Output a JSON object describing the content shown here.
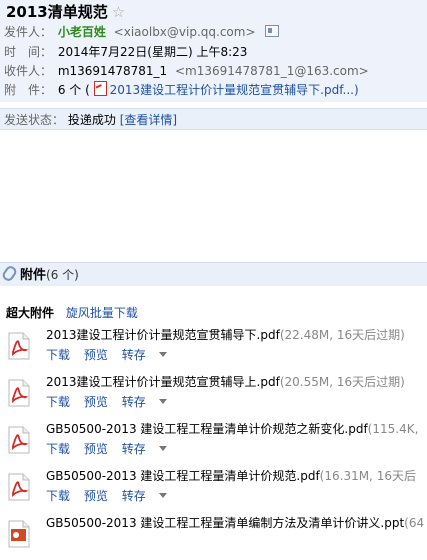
{
  "header": {
    "subject": "2013清单规范",
    "star": "☆",
    "sender_label": "发件人：",
    "sender_name": "小老百姓",
    "sender_email": "<xiaolbx@vip.qq.com>",
    "time_label": "时　间：",
    "time_value": "2014年7月22日(星期二) 上午8:23",
    "recipient_label": "收件人：",
    "recipient_name": "m13691478781_1",
    "recipient_email": "<m13691478781_1@163.com>",
    "attach_label": "附　件：",
    "attach_count": "6 个 (",
    "attach_first": "2013建设工程计价计量规范宣贯辅导下.pdf...)"
  },
  "status": {
    "label": "发送状态：",
    "value": "投递成功",
    "details_link": "[查看详情]"
  },
  "attachments": {
    "title": "附件",
    "count": "(6 个)",
    "super_label": "超大附件",
    "batch_download": "旋风批量下载",
    "download": "下载",
    "preview": "预览",
    "forward": "转存",
    "items": [
      {
        "name": "2013建设工程计价计量规范宣贯辅导下.pdf",
        "meta": "(22.48M, 16天后过期)",
        "icon": "pdf-icon"
      },
      {
        "name": "2013建设工程计价计量规范宣贯辅导上.pdf",
        "meta": "(20.55M, 16天后过期)",
        "icon": "pdf-icon"
      },
      {
        "name": "GB50500-2013 建设工程工程量清单计价规范之新变化.pdf",
        "meta": "(115.4K,",
        "icon": "pdf-icon"
      },
      {
        "name": "GB50500-2013 建设工程工程量清单计价规范.pdf",
        "meta": "(16.31M, 16天后",
        "icon": "pdf-icon"
      },
      {
        "name": "GB50500-2013 建设工程工程量清单编制方法及清单计价讲义.ppt",
        "meta": "(64",
        "icon": "ppt-icon"
      }
    ]
  }
}
